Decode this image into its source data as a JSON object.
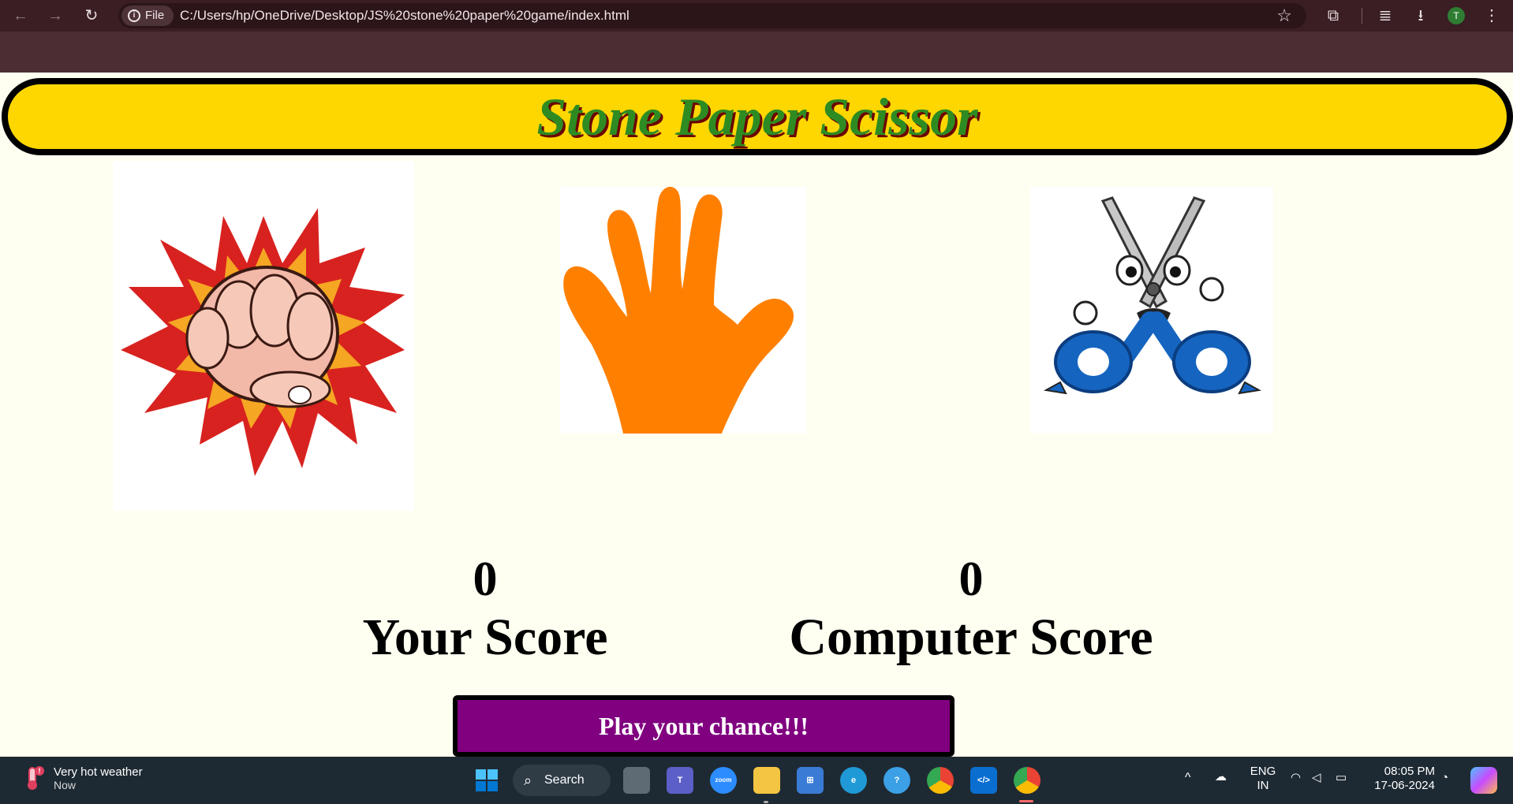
{
  "browser": {
    "file_chip": "File",
    "url": "C:/Users/hp/OneDrive/Desktop/JS%20stone%20paper%20game/index.html",
    "profile_initial": "T"
  },
  "page": {
    "title": "Stone Paper Scissor",
    "choices": [
      {
        "name": "stone",
        "icon": "fist-punch-icon"
      },
      {
        "name": "paper",
        "icon": "orange-hand-icon"
      },
      {
        "name": "scissor",
        "icon": "cartoon-scissors-icon"
      }
    ],
    "user_score": "0",
    "user_score_label": "Your Score",
    "computer_score": "0",
    "computer_score_label": "Computer Score",
    "message": "Play your chance!!!"
  },
  "colors": {
    "banner_bg": "#ffd700",
    "title_green": "#2e8b22",
    "message_bg": "#800080",
    "page_bg": "#fefff0"
  },
  "taskbar": {
    "weather_title": "Very hot weather",
    "weather_sub": "Now",
    "search_label": "Search",
    "zoom_label": "zoom",
    "lang_top": "ENG",
    "lang_bottom": "IN",
    "time": "08:05 PM",
    "date": "17-06-2024"
  }
}
